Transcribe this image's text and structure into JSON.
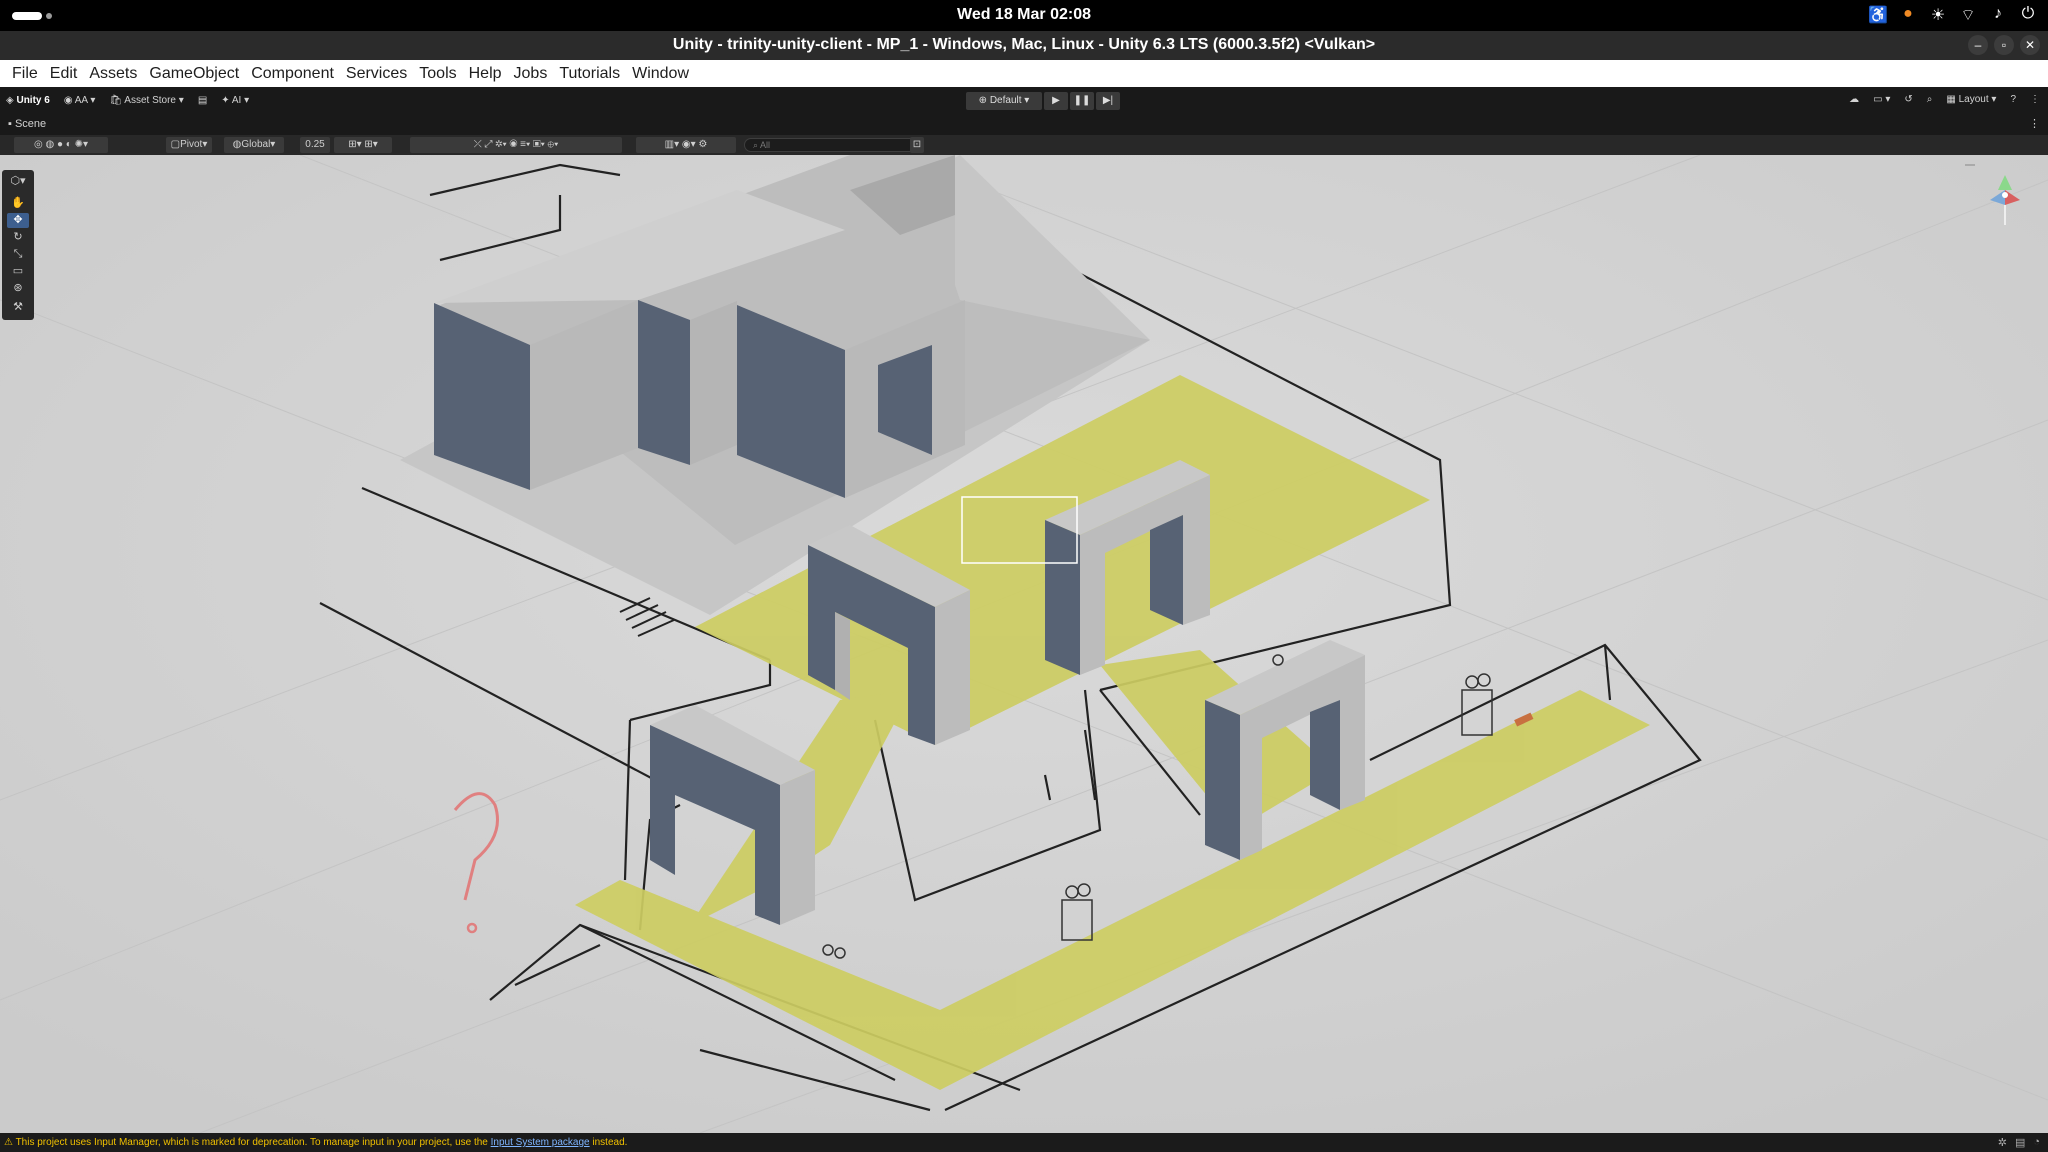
{
  "system": {
    "clock": "Wed 18 Mar  02:08",
    "tray_icons": [
      "accessibility-icon",
      "microphone-icon",
      "brightness-icon",
      "wifi-icon",
      "volume-icon",
      "power-icon"
    ]
  },
  "window": {
    "title": "Unity - trinity-unity-client - MP_1 - Windows, Mac, Linux - Unity 6.3 LTS (6000.3.5f2) <Vulkan>"
  },
  "menu": [
    "File",
    "Edit",
    "Assets",
    "GameObject",
    "Component",
    "Services",
    "Tools",
    "Help",
    "Jobs",
    "Tutorials",
    "Window"
  ],
  "toolbar": {
    "unity_label": "Unity 6",
    "account_label": "AA",
    "asset_store_label": "Asset Store",
    "ai_label": "AI",
    "play_mode_label": "Default",
    "layout_label": "Layout"
  },
  "scene_tab": {
    "label": "Scene"
  },
  "scene_toolbar": {
    "pivot_label": "Pivot",
    "global_label": "Global",
    "snap_value": "0.25",
    "search_placeholder": "All"
  },
  "status": {
    "message_prefix": "This project uses Input Manager, which is marked for deprecation. To manage input in your project, use the",
    "link_text": "Input System package",
    "message_suffix": "instead."
  },
  "colors": {
    "accent_yellow": "#cdcd62",
    "wall_dark": "#576274",
    "wall_light": "#bcbcbc",
    "warning": "#f0c000"
  }
}
